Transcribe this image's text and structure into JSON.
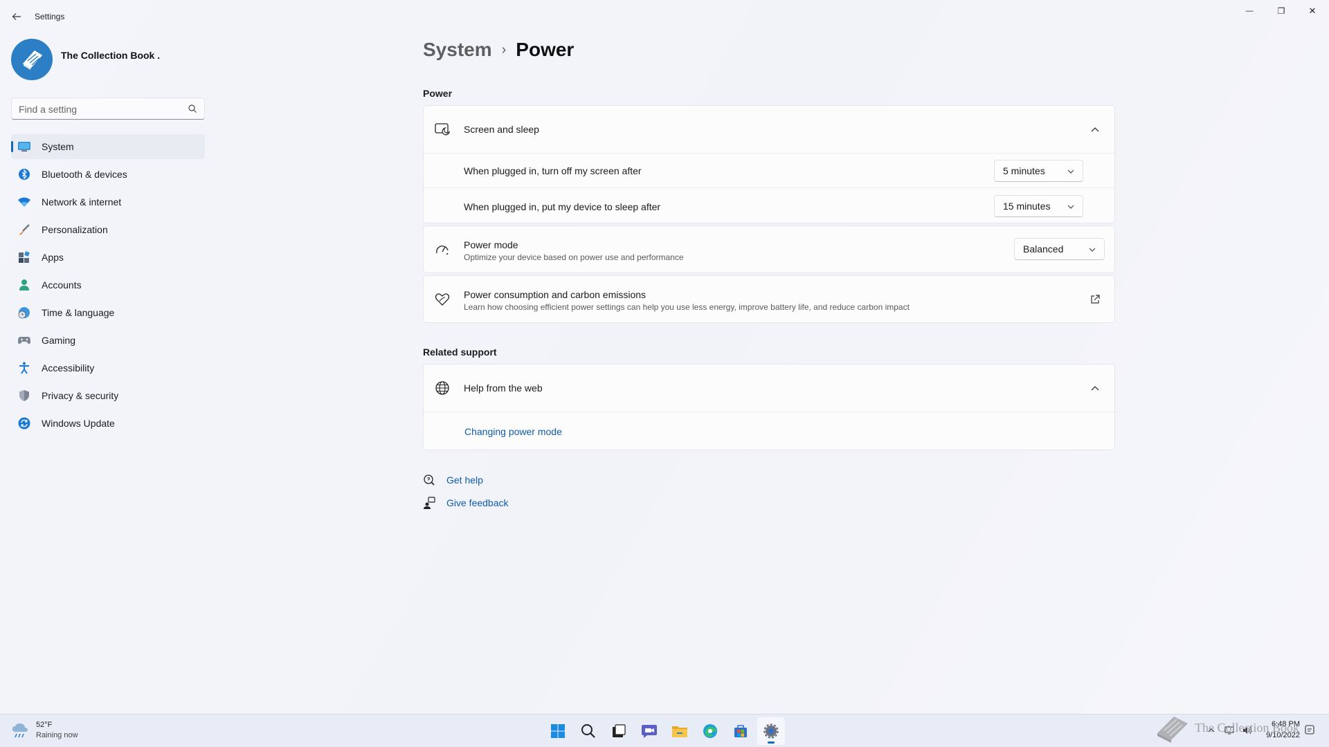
{
  "window": {
    "title": "Settings",
    "controls": {
      "minimize": "—",
      "maximize": "❐",
      "close": "✕"
    }
  },
  "profile": {
    "name": "The Collection Book ."
  },
  "search": {
    "placeholder": "Find a setting"
  },
  "sidebar": {
    "items": [
      {
        "label": "System",
        "icon": "system-display-icon",
        "active": true
      },
      {
        "label": "Bluetooth & devices",
        "icon": "bluetooth-icon"
      },
      {
        "label": "Network & internet",
        "icon": "wifi-icon"
      },
      {
        "label": "Personalization",
        "icon": "brush-icon"
      },
      {
        "label": "Apps",
        "icon": "apps-icon"
      },
      {
        "label": "Accounts",
        "icon": "person-icon"
      },
      {
        "label": "Time & language",
        "icon": "globe-clock-icon"
      },
      {
        "label": "Gaming",
        "icon": "controller-icon"
      },
      {
        "label": "Accessibility",
        "icon": "accessibility-icon"
      },
      {
        "label": "Privacy & security",
        "icon": "shield-icon"
      },
      {
        "label": "Windows Update",
        "icon": "update-icon"
      }
    ]
  },
  "breadcrumb": {
    "parent": "System",
    "separator": "›",
    "current": "Power"
  },
  "power_section": {
    "heading": "Power",
    "screen_sleep": {
      "title": "Screen and sleep",
      "rows": [
        {
          "label": "When plugged in, turn off my screen after",
          "value": "5 minutes"
        },
        {
          "label": "When plugged in, put my device to sleep after",
          "value": "15 minutes"
        }
      ]
    },
    "power_mode": {
      "title": "Power mode",
      "subtitle": "Optimize your device based on power use and performance",
      "value": "Balanced"
    },
    "carbon": {
      "title": "Power consumption and carbon emissions",
      "subtitle": "Learn how choosing efficient power settings can help you use less energy, improve battery life, and reduce carbon impact"
    }
  },
  "related_support": {
    "heading": "Related support",
    "help_web": {
      "title": "Help from the web",
      "link": "Changing power mode"
    }
  },
  "help_links": {
    "get_help": "Get help",
    "give_feedback": "Give feedback"
  },
  "taskbar": {
    "weather": {
      "temp": "52°F",
      "condition": "Raining now"
    },
    "apps": [
      "start-icon",
      "search-icon",
      "task-view-icon",
      "teams-chat-icon",
      "file-explorer-icon",
      "edge-icon",
      "store-icon",
      "settings-icon"
    ],
    "clock": {
      "time": "6:48 PM",
      "date": "9/10/2022"
    }
  },
  "watermark": {
    "text": "The Collection Book"
  },
  "colors": {
    "accent": "#0f6cbd",
    "link": "#0f5ba8",
    "background": "#f3f4f9"
  }
}
